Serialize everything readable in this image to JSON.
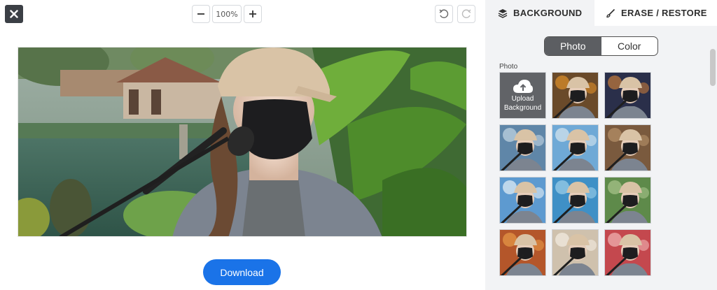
{
  "toolbar": {
    "zoom_value": "100%"
  },
  "download_label": "Download",
  "panel": {
    "tabs": [
      {
        "label": "BACKGROUND"
      },
      {
        "label": "ERASE / RESTORE"
      }
    ],
    "segment": {
      "options": [
        "Photo",
        "Color"
      ],
      "selected": "Photo"
    },
    "section_label": "Photo",
    "upload_label_1": "Upload",
    "upload_label_2": "Background",
    "thumbnails": [
      {
        "name": "bokeh-orange"
      },
      {
        "name": "city-night"
      },
      {
        "name": "city-skyline"
      },
      {
        "name": "beach-palm"
      },
      {
        "name": "brown-room"
      },
      {
        "name": "sky-clouds"
      },
      {
        "name": "ocean-blue"
      },
      {
        "name": "tropical-green"
      },
      {
        "name": "autumn-leaves"
      },
      {
        "name": "bright-window"
      },
      {
        "name": "pink-bokeh"
      }
    ]
  }
}
